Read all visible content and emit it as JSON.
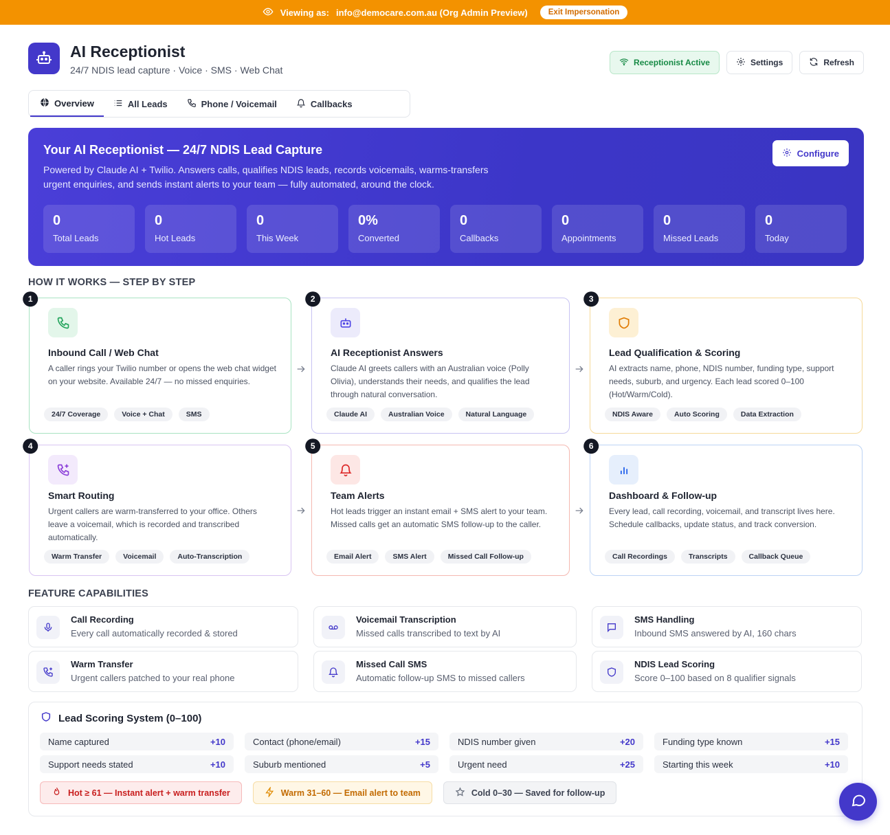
{
  "banner": {
    "prefix": "Viewing as:",
    "identity": "info@democare.com.au (Org Admin Preview)",
    "exit_label": "Exit Impersonation"
  },
  "header": {
    "title": "AI Receptionist",
    "subtitle": "24/7 NDIS lead capture · Voice · SMS · Web Chat",
    "status_label": "Receptionist Active",
    "settings_label": "Settings",
    "refresh_label": "Refresh"
  },
  "tabs": [
    {
      "label": "Overview",
      "icon": "globe-icon"
    },
    {
      "label": "All Leads",
      "icon": "list-icon"
    },
    {
      "label": "Phone / Voicemail",
      "icon": "phone-icon"
    },
    {
      "label": "Callbacks",
      "icon": "bell-icon"
    }
  ],
  "hero": {
    "title": "Your AI Receptionist — 24/7 NDIS Lead Capture",
    "description": "Powered by Claude AI + Twilio. Answers calls, qualifies NDIS leads, records voicemails, warms-transfers urgent enquiries, and sends instant alerts to your team — fully automated, around the clock.",
    "configure_label": "Configure",
    "stats": [
      {
        "value": "0",
        "label": "Total Leads"
      },
      {
        "value": "0",
        "label": "Hot Leads"
      },
      {
        "value": "0",
        "label": "This Week"
      },
      {
        "value": "0%",
        "label": "Converted"
      },
      {
        "value": "0",
        "label": "Callbacks"
      },
      {
        "value": "0",
        "label": "Appointments"
      },
      {
        "value": "0",
        "label": "Missed Leads"
      },
      {
        "value": "0",
        "label": "Today"
      }
    ]
  },
  "how_it_works": {
    "title": "HOW IT WORKS — STEP BY STEP",
    "steps": [
      {
        "num": "1",
        "title": "Inbound Call / Web Chat",
        "desc": "A caller rings your Twilio number or opens the web chat widget on your website. Available 24/7 — no missed enquiries.",
        "tags": [
          "24/7 Coverage",
          "Voice + Chat",
          "SMS"
        ],
        "icon": "phone-icon",
        "color": "#23a45c"
      },
      {
        "num": "2",
        "title": "AI Receptionist Answers",
        "desc": "Claude AI greets callers with an Australian voice (Polly Olivia), understands their needs, and qualifies the lead through natural conversation.",
        "tags": [
          "Claude AI",
          "Australian Voice",
          "Natural Language"
        ],
        "icon": "robot-icon",
        "color": "#4f46e5"
      },
      {
        "num": "3",
        "title": "Lead Qualification & Scoring",
        "desc": "AI extracts name, phone, NDIS number, funding type, support needs, suburb, and urgency. Each lead scored 0–100 (Hot/Warm/Cold).",
        "tags": [
          "NDIS Aware",
          "Auto Scoring",
          "Data Extraction"
        ],
        "icon": "shield-icon",
        "color": "#e07a00"
      },
      {
        "num": "4",
        "title": "Smart Routing",
        "desc": "Urgent callers are warm-transferred to your office. Others leave a voicemail, which is recorded and transcribed automatically.",
        "tags": [
          "Warm Transfer",
          "Voicemail",
          "Auto-Transcription"
        ],
        "icon": "phone-forward-icon",
        "color": "#8b3fd9"
      },
      {
        "num": "5",
        "title": "Team Alerts",
        "desc": "Hot leads trigger an instant email + SMS alert to your team. Missed calls get an automatic SMS follow-up to the caller.",
        "tags": [
          "Email Alert",
          "SMS Alert",
          "Missed Call Follow-up"
        ],
        "icon": "bell-icon",
        "color": "#dc2626"
      },
      {
        "num": "6",
        "title": "Dashboard & Follow-up",
        "desc": "Every lead, call recording, voicemail, and transcript lives here. Schedule callbacks, update status, and track conversion.",
        "tags": [
          "Call Recordings",
          "Transcripts",
          "Callback Queue"
        ],
        "icon": "bar-chart-icon",
        "color": "#2563eb"
      }
    ]
  },
  "features": {
    "title": "FEATURE CAPABILITIES",
    "items": [
      {
        "title": "Call Recording",
        "desc": "Every call automatically recorded & stored",
        "icon": "mic-icon"
      },
      {
        "title": "Voicemail Transcription",
        "desc": "Missed calls transcribed to text by AI",
        "icon": "voicemail-icon"
      },
      {
        "title": "SMS Handling",
        "desc": "Inbound SMS answered by AI, 160 chars",
        "icon": "message-icon"
      },
      {
        "title": "Warm Transfer",
        "desc": "Urgent callers patched to your real phone",
        "icon": "phone-forward-icon"
      },
      {
        "title": "Missed Call SMS",
        "desc": "Automatic follow-up SMS to missed callers",
        "icon": "bell-icon"
      },
      {
        "title": "NDIS Lead Scoring",
        "desc": "Score 0–100 based on 8 qualifier signals",
        "icon": "shield-icon"
      }
    ]
  },
  "scoring": {
    "title": "Lead Scoring System (0–100)",
    "rows": [
      [
        {
          "label": "Name captured",
          "points": "+10"
        },
        {
          "label": "Contact (phone/email)",
          "points": "+15"
        },
        {
          "label": "NDIS number given",
          "points": "+20"
        },
        {
          "label": "Funding type known",
          "points": "+15"
        }
      ],
      [
        {
          "label": "Support needs stated",
          "points": "+10"
        },
        {
          "label": "Suburb mentioned",
          "points": "+5"
        },
        {
          "label": "Urgent need",
          "points": "+25"
        },
        {
          "label": "Starting this week",
          "points": "+10"
        }
      ]
    ],
    "legend": [
      {
        "label": "Hot ≥ 61 — Instant alert + warm transfer",
        "icon": "flame-icon"
      },
      {
        "label": "Warm 31–60 — Email alert to team",
        "icon": "bolt-icon"
      },
      {
        "label": "Cold 0–30 — Saved for follow-up",
        "icon": "star-icon"
      }
    ]
  }
}
